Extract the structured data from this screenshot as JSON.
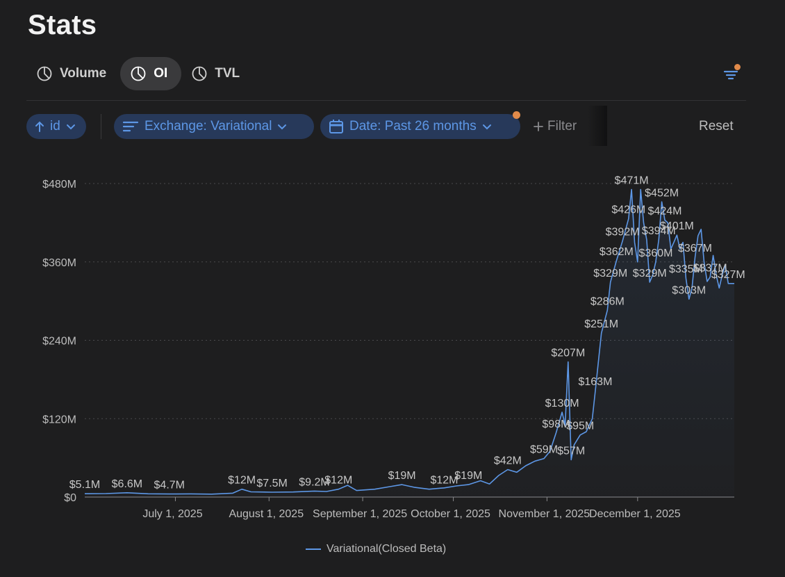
{
  "page": {
    "title": "Stats"
  },
  "tabs": [
    {
      "label": "Volume",
      "icon": "pie-chart-icon",
      "active": false
    },
    {
      "label": "OI",
      "icon": "pie-chart-icon",
      "active": true
    },
    {
      "label": "TVL",
      "icon": "pie-chart-icon",
      "active": false
    }
  ],
  "toolbar": {
    "sort_chip": "id",
    "exchange_chip": "Exchange: Variational",
    "date_chip": "Date: Past 26 months",
    "add_filter": "Filter",
    "reset": "Reset",
    "filter_icon": "filter-lines-icon",
    "accent": "#5d97e6",
    "notification_color": "#e08a4a"
  },
  "chart_data": {
    "type": "area",
    "series": [
      {
        "name": "Variational(Closed Beta)",
        "color": "#5d97e6",
        "points": [
          [
            "2025-06-01",
            5.1
          ],
          [
            "2025-06-08",
            5.3
          ],
          [
            "2025-06-15",
            6.6
          ],
          [
            "2025-06-22",
            5.0
          ],
          [
            "2025-06-29",
            4.7
          ],
          [
            "2025-07-06",
            4.9
          ],
          [
            "2025-07-13",
            4.5
          ],
          [
            "2025-07-20",
            6.0
          ],
          [
            "2025-07-23",
            12
          ],
          [
            "2025-07-26",
            8
          ],
          [
            "2025-08-02",
            7.5
          ],
          [
            "2025-08-09",
            7.8
          ],
          [
            "2025-08-16",
            9.2
          ],
          [
            "2025-08-20",
            8.5
          ],
          [
            "2025-08-24",
            12
          ],
          [
            "2025-08-27",
            18
          ],
          [
            "2025-08-30",
            10
          ],
          [
            "2025-09-05",
            12
          ],
          [
            "2025-09-10",
            16
          ],
          [
            "2025-09-14",
            19
          ],
          [
            "2025-09-18",
            15
          ],
          [
            "2025-09-23",
            12
          ],
          [
            "2025-09-28",
            14
          ],
          [
            "2025-10-02",
            17
          ],
          [
            "2025-10-06",
            19
          ],
          [
            "2025-10-10",
            25
          ],
          [
            "2025-10-13",
            20
          ],
          [
            "2025-10-16",
            33
          ],
          [
            "2025-10-19",
            42
          ],
          [
            "2025-10-22",
            38
          ],
          [
            "2025-10-25",
            48
          ],
          [
            "2025-10-28",
            55
          ],
          [
            "2025-10-31",
            59
          ],
          [
            "2025-11-02",
            70
          ],
          [
            "2025-11-04",
            98
          ],
          [
            "2025-11-06",
            130
          ],
          [
            "2025-11-07",
            110
          ],
          [
            "2025-11-08",
            207
          ],
          [
            "2025-11-09",
            57
          ],
          [
            "2025-11-10",
            80
          ],
          [
            "2025-11-12",
            95
          ],
          [
            "2025-11-14",
            100
          ],
          [
            "2025-11-16",
            120
          ],
          [
            "2025-11-17",
            163
          ],
          [
            "2025-11-19",
            251
          ],
          [
            "2025-11-21",
            286
          ],
          [
            "2025-11-22",
            329
          ],
          [
            "2025-11-24",
            362
          ],
          [
            "2025-11-26",
            392
          ],
          [
            "2025-11-28",
            426
          ],
          [
            "2025-11-29",
            471
          ],
          [
            "2025-11-30",
            390
          ],
          [
            "2025-12-01",
            360
          ],
          [
            "2025-12-02",
            471
          ],
          [
            "2025-12-03",
            420
          ],
          [
            "2025-12-04",
            394
          ],
          [
            "2025-12-05",
            329
          ],
          [
            "2025-12-06",
            340
          ],
          [
            "2025-12-07",
            360
          ],
          [
            "2025-12-08",
            394
          ],
          [
            "2025-12-09",
            452
          ],
          [
            "2025-12-10",
            424
          ],
          [
            "2025-12-11",
            420
          ],
          [
            "2025-12-12",
            380
          ],
          [
            "2025-12-13",
            390
          ],
          [
            "2025-12-14",
            401
          ],
          [
            "2025-12-15",
            380
          ],
          [
            "2025-12-16",
            390
          ],
          [
            "2025-12-17",
            335
          ],
          [
            "2025-12-18",
            303
          ],
          [
            "2025-12-19",
            320
          ],
          [
            "2025-12-20",
            367
          ],
          [
            "2025-12-21",
            400
          ],
          [
            "2025-12-22",
            410
          ],
          [
            "2025-12-23",
            360
          ],
          [
            "2025-12-24",
            330
          ],
          [
            "2025-12-25",
            337
          ],
          [
            "2025-12-26",
            370
          ],
          [
            "2025-12-27",
            340
          ],
          [
            "2025-12-28",
            320
          ],
          [
            "2025-12-29",
            340
          ],
          [
            "2025-12-30",
            355
          ],
          [
            "2025-12-31",
            327
          ],
          [
            "2026-01-02",
            327
          ]
        ]
      }
    ],
    "data_labels": [
      [
        "2025-06-01",
        5.1,
        "$5.1M"
      ],
      [
        "2025-06-15",
        6.6,
        "$6.6M"
      ],
      [
        "2025-06-29",
        4.7,
        "$4.7M"
      ],
      [
        "2025-07-23",
        12,
        "$12M"
      ],
      [
        "2025-08-02",
        7.5,
        "$7.5M"
      ],
      [
        "2025-08-16",
        9.2,
        "$9.2M"
      ],
      [
        "2025-08-24",
        12,
        "$12M"
      ],
      [
        "2025-09-14",
        19,
        "$19M"
      ],
      [
        "2025-09-28",
        12,
        "$12M"
      ],
      [
        "2025-10-06",
        19,
        "$19M"
      ],
      [
        "2025-10-19",
        42,
        "$42M"
      ],
      [
        "2025-10-31",
        59,
        "$59M"
      ],
      [
        "2025-11-04",
        98,
        "$98M"
      ],
      [
        "2025-11-06",
        130,
        "$130M"
      ],
      [
        "2025-11-08",
        207,
        "$207M"
      ],
      [
        "2025-11-09",
        57,
        "$57M"
      ],
      [
        "2025-11-12",
        95,
        "$95M"
      ],
      [
        "2025-11-17",
        163,
        "$163M"
      ],
      [
        "2025-11-19",
        251,
        "$251M"
      ],
      [
        "2025-11-21",
        286,
        "$286M"
      ],
      [
        "2025-11-22",
        329,
        "$329M"
      ],
      [
        "2025-11-24",
        362,
        "$362M"
      ],
      [
        "2025-11-26",
        392,
        "$392M"
      ],
      [
        "2025-11-28",
        426,
        "$426M"
      ],
      [
        "2025-11-29",
        471,
        "$471M"
      ],
      [
        "2025-12-05",
        329,
        "$329M"
      ],
      [
        "2025-12-07",
        360,
        "$360M"
      ],
      [
        "2025-12-08",
        394,
        "$394M"
      ],
      [
        "2025-12-09",
        452,
        "$452M"
      ],
      [
        "2025-12-10",
        424,
        "$424M"
      ],
      [
        "2025-12-14",
        401,
        "$401M"
      ],
      [
        "2025-12-17",
        335,
        "$335M"
      ],
      [
        "2025-12-18",
        303,
        "$303M"
      ],
      [
        "2025-12-20",
        367,
        "$367M"
      ],
      [
        "2025-12-25",
        337,
        "$337M"
      ],
      [
        "2025-12-31",
        327,
        "$327M"
      ]
    ],
    "y_ticks": [
      [
        0,
        "$0"
      ],
      [
        120,
        "$120M"
      ],
      [
        240,
        "$240M"
      ],
      [
        360,
        "$360M"
      ],
      [
        480,
        "$480M"
      ]
    ],
    "x_ticks": [
      [
        "2025-07-01",
        "July 1, 2025"
      ],
      [
        "2025-08-01",
        "August 1, 2025"
      ],
      [
        "2025-09-01",
        "September 1, 2025"
      ],
      [
        "2025-10-01",
        "October 1, 2025"
      ],
      [
        "2025-11-01",
        "November 1, 2025"
      ],
      [
        "2025-12-01",
        "December 1, 2025"
      ]
    ],
    "xlim": [
      "2025-06-01",
      "2026-01-02"
    ],
    "ylim": [
      0,
      480
    ],
    "grid": true,
    "legend": "bottom-center"
  }
}
